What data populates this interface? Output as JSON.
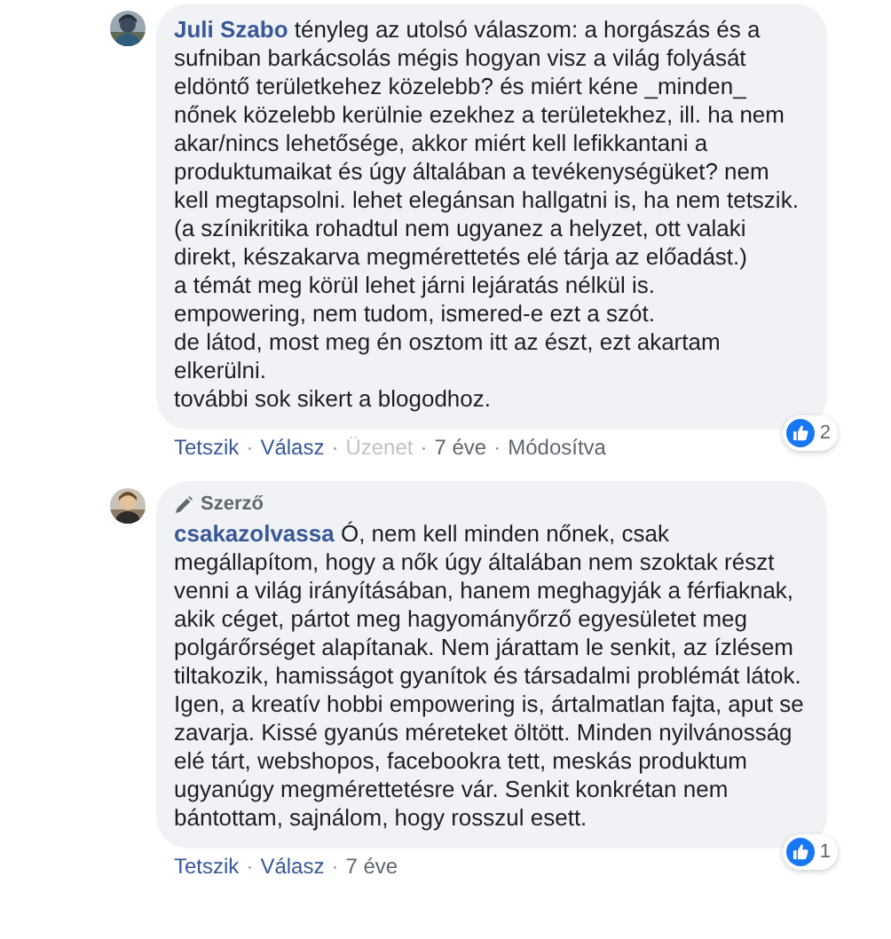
{
  "comments": [
    {
      "author": "Juli Szabo",
      "text": "tényleg az utolsó válaszom: a horgászás és a sufniban barkácsolás mégis hogyan visz a világ folyását eldöntő területkehez közelebb? és miért kéne _minden_ nőnek közelebb kerülnie ezekhez a területekhez, ill. ha nem akar/nincs lehetősége, akkor miért kell lefikkantani a produktumaikat és úgy általában a tevékenységüket? nem kell megtapsolni. lehet elegánsan hallgatni is, ha nem tetszik.\n(a színikritika rohadtul nem ugyanez a helyzet, ott valaki direkt, készakarva megmérettetés elé tárja az előadást.)\na témát meg körül lehet járni lejáratás nélkül is.\nempowering, nem tudom, ismered-e ezt a szót.\nde látod, most meg én osztom itt az észt, ezt akartam elkerülni.\ntovábbi sok sikert a blogodhoz.",
      "reaction_count": "2",
      "separator": "·",
      "actions": [
        {
          "label": "Tetszik",
          "kind": "link"
        },
        {
          "label": "Válasz",
          "kind": "link"
        },
        {
          "label": "Üzenet",
          "kind": "muted"
        },
        {
          "label": "7 éve",
          "kind": "meta"
        },
        {
          "label": "Módosítva",
          "kind": "meta"
        }
      ]
    },
    {
      "author_badge": "Szerző",
      "author": "csakazolvassa",
      "text": "Ó, nem kell minden nőnek, csak megállapítom, hogy a nők úgy általában nem szoktak részt venni a világ irányításában, hanem meghagyják a férfiaknak, akik céget, pártot meg hagyományőrző egyesületet meg polgárőrséget alapítanak. Nem járattam le senkit, az ízlésem tiltakozik, hamisságot gyanítok és társadalmi problémát látok. Igen, a kreatív hobbi empowering is, ártalmatlan fajta, aput se zavarja. Kissé gyanús méreteket öltött. Minden nyilvánosság elé tárt, webshopos, facebookra tett, meskás produktum ugyanúgy megmérettetésre vár. Senkit konkrétan nem bántottam, sajnálom, hogy rosszul esett.",
      "reaction_count": "1",
      "separator": "·",
      "actions": [
        {
          "label": "Tetszik",
          "kind": "link"
        },
        {
          "label": "Válasz",
          "kind": "link"
        },
        {
          "label": "7 éve",
          "kind": "meta"
        }
      ]
    }
  ]
}
